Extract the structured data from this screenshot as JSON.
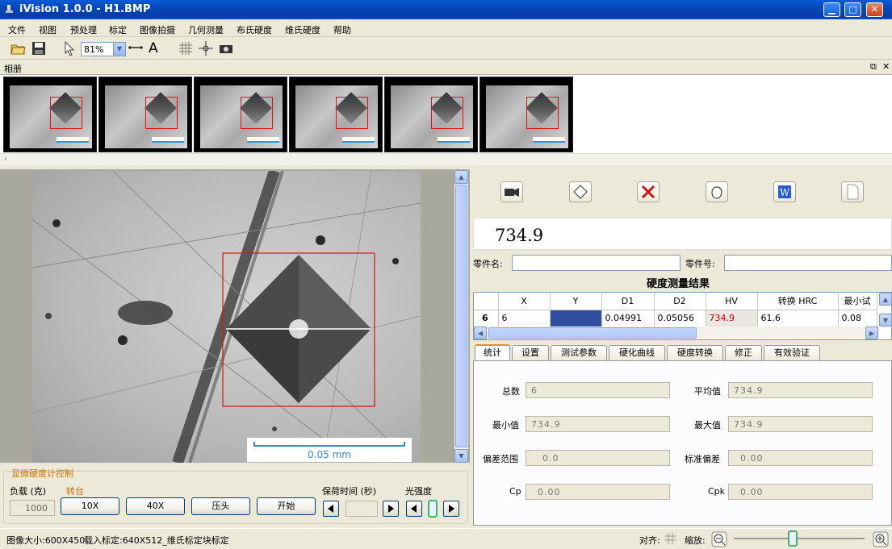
{
  "window": {
    "title": "iVision 1.0.0 - H1.BMP",
    "minimize": "▁",
    "maximize": "□",
    "close": "✕"
  },
  "menu": [
    "文件",
    "视图",
    "预处理",
    "标定",
    "图像拍摄",
    "几何测量",
    "布氏硬度",
    "维氏硬度",
    "帮助"
  ],
  "toolbar": {
    "zoom_value": "81%",
    "text_tool": "A"
  },
  "album": {
    "title": "相册",
    "thumbnail_count": 6
  },
  "scale_bar": {
    "label": "0.05 mm"
  },
  "result": {
    "value": "734.9",
    "part_name_label": "零件名:",
    "part_name_value": "",
    "part_no_label": "零件号:",
    "part_no_value": "",
    "table_title": "硬度测量结果",
    "columns": [
      "",
      "X",
      "Y",
      "D1",
      "D2",
      "HV",
      "转换 HRC",
      "最小试"
    ],
    "row": {
      "index": "6",
      "x": "6",
      "y": "",
      "d1": "0.04991",
      "d2": "0.05056",
      "hv": "734.9",
      "hrc": "61.6",
      "min": "0.08"
    }
  },
  "tabs": [
    "统计",
    "设置",
    "测试参数",
    "硬化曲线",
    "硬度转换",
    "修正",
    "有效验证"
  ],
  "stats": {
    "total_label": "总数",
    "total": "6",
    "mean_label": "平均值",
    "mean": "734.9",
    "min_label": "最小值",
    "min": "734.9",
    "max_label": "最大值",
    "max": "734.9",
    "range_label": "偏差范围",
    "range": "0.0",
    "std_label": "标准偏差",
    "std": "0.00",
    "cp_label": "Cp",
    "cp": "0.00",
    "cpk_label": "Cpk",
    "cpk": "0.00"
  },
  "control": {
    "title": "显微硬度计控制",
    "load_label": "负载 (克)",
    "load_value": "1000",
    "turret_label": "转台",
    "btn_10x": "10X",
    "btn_40x": "40X",
    "btn_indenter": "压头",
    "btn_start": "开始",
    "hold_label": "保荷时间 (秒)",
    "hold_value": "",
    "light_label": "光强度"
  },
  "status": {
    "image_size": "图像大小:600X450",
    "calibration": "载入标定:640X512_维氏标定块标定",
    "align_label": "对齐:",
    "zoom_label": "缩放:"
  },
  "colors": {
    "title_bar": "#0747b8",
    "accent_orange": "#c8700a",
    "selection_red": "#e01010",
    "scale_blue": "#3a86c8",
    "hv_red": "#c00000"
  }
}
